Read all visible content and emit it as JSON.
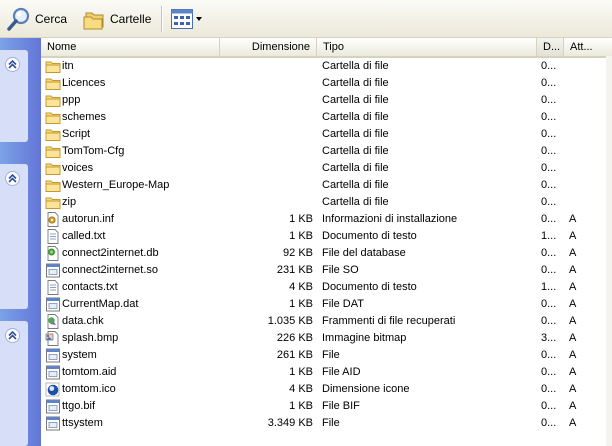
{
  "toolbar": {
    "search_label": "Cerca",
    "folders_label": "Cartelle",
    "search_icon": "magnifier-icon",
    "folders_icon": "folders-icon",
    "views_icon": "views-grid-icon"
  },
  "columns": {
    "name": "Nome",
    "size": "Dimensione",
    "type": "Tipo",
    "date": "D...",
    "attr": "Att..."
  },
  "files": [
    {
      "name": "itn",
      "size": "",
      "type": "Cartella di file",
      "date": "0...",
      "attr": "",
      "icon": "folder-icon"
    },
    {
      "name": "Licences",
      "size": "",
      "type": "Cartella di file",
      "date": "0...",
      "attr": "",
      "icon": "folder-icon"
    },
    {
      "name": "ppp",
      "size": "",
      "type": "Cartella di file",
      "date": "0...",
      "attr": "",
      "icon": "folder-icon"
    },
    {
      "name": "schemes",
      "size": "",
      "type": "Cartella di file",
      "date": "0...",
      "attr": "",
      "icon": "folder-icon"
    },
    {
      "name": "Script",
      "size": "",
      "type": "Cartella di file",
      "date": "0...",
      "attr": "",
      "icon": "folder-icon"
    },
    {
      "name": "TomTom-Cfg",
      "size": "",
      "type": "Cartella di file",
      "date": "0...",
      "attr": "",
      "icon": "folder-icon"
    },
    {
      "name": "voices",
      "size": "",
      "type": "Cartella di file",
      "date": "0...",
      "attr": "",
      "icon": "folder-icon"
    },
    {
      "name": "Western_Europe-Map",
      "size": "",
      "type": "Cartella di file",
      "date": "0...",
      "attr": "",
      "icon": "folder-icon"
    },
    {
      "name": "zip",
      "size": "",
      "type": "Cartella di file",
      "date": "0...",
      "attr": "",
      "icon": "folder-icon"
    },
    {
      "name": "autorun.inf",
      "size": "1 KB",
      "type": "Informazioni di installazione",
      "date": "0...",
      "attr": "A",
      "icon": "setup-info-icon"
    },
    {
      "name": "called.txt",
      "size": "1 KB",
      "type": "Documento di testo",
      "date": "1...",
      "attr": "A",
      "icon": "text-file-icon"
    },
    {
      "name": "connect2internet.db",
      "size": "92 KB",
      "type": "File del database",
      "date": "0...",
      "attr": "A",
      "icon": "database-file-icon"
    },
    {
      "name": "connect2internet.so",
      "size": "231 KB",
      "type": "File SO",
      "date": "0...",
      "attr": "A",
      "icon": "generic-file-icon"
    },
    {
      "name": "contacts.txt",
      "size": "4 KB",
      "type": "Documento di testo",
      "date": "1...",
      "attr": "A",
      "icon": "text-file-icon"
    },
    {
      "name": "CurrentMap.dat",
      "size": "1 KB",
      "type": "File DAT",
      "date": "0...",
      "attr": "A",
      "icon": "generic-file-icon"
    },
    {
      "name": "data.chk",
      "size": "1.035 KB",
      "type": "Frammenti di file recuperati",
      "date": "0...",
      "attr": "A",
      "icon": "recovered-file-icon"
    },
    {
      "name": "splash.bmp",
      "size": "226 KB",
      "type": "Immagine bitmap",
      "date": "3...",
      "attr": "A",
      "icon": "bitmap-icon"
    },
    {
      "name": "system",
      "size": "261 KB",
      "type": "File",
      "date": "0...",
      "attr": "A",
      "icon": "generic-file-icon"
    },
    {
      "name": "tomtom.aid",
      "size": "1 KB",
      "type": "File AID",
      "date": "0...",
      "attr": "A",
      "icon": "generic-file-icon"
    },
    {
      "name": "tomtom.ico",
      "size": "4 KB",
      "type": "Dimensione icone",
      "date": "0...",
      "attr": "A",
      "icon": "icon-file-icon"
    },
    {
      "name": "ttgo.bif",
      "size": "1 KB",
      "type": "File BIF",
      "date": "0...",
      "attr": "A",
      "icon": "generic-file-icon"
    },
    {
      "name": "ttsystem",
      "size": "3.349 KB",
      "type": "File",
      "date": "0...",
      "attr": "A",
      "icon": "generic-file-icon"
    }
  ]
}
